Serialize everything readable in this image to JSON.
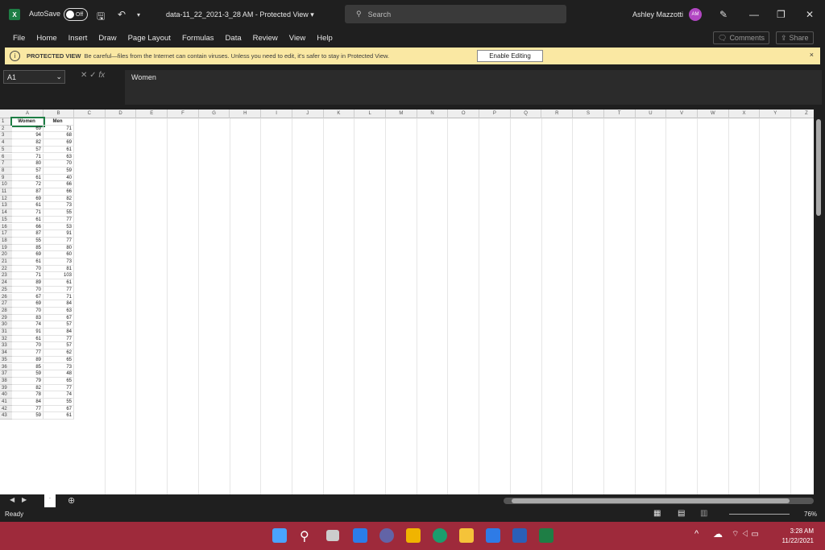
{
  "titlebar": {
    "autosave_label": "AutoSave",
    "autosave_state": "Off",
    "filename": "data-11_22_2021-3_28 AM",
    "separator": " - ",
    "view_mode": "Protected View",
    "search_placeholder": "Search",
    "user_name": "Ashley Mazzotti",
    "user_initials": "AM"
  },
  "menu": [
    "File",
    "Home",
    "Insert",
    "Draw",
    "Page Layout",
    "Formulas",
    "Data",
    "Review",
    "View",
    "Help"
  ],
  "ribbon_buttons": {
    "comments": "Comments",
    "share": "Share"
  },
  "protected": {
    "label": "PROTECTED VIEW",
    "message": "Be careful—files from the Internet can contain viruses. Unless you need to edit, it's safer to stay in Protected View.",
    "enable_button": "Enable Editing",
    "close": "×"
  },
  "formula_bar": {
    "namebox": "A1",
    "fx": "fx",
    "value": "Women"
  },
  "columns": [
    "A",
    "B",
    "C",
    "D",
    "E",
    "F",
    "G",
    "H",
    "I",
    "J",
    "K",
    "L",
    "M",
    "N",
    "O",
    "P",
    "Q",
    "R",
    "S",
    "T",
    "U",
    "V",
    "W",
    "X",
    "Y",
    "Z"
  ],
  "headers": {
    "A": "Women",
    "B": "Men"
  },
  "rows": [
    [
      69,
      71
    ],
    [
      94,
      68
    ],
    [
      82,
      69
    ],
    [
      57,
      61
    ],
    [
      71,
      63
    ],
    [
      80,
      70
    ],
    [
      57,
      59
    ],
    [
      61,
      40
    ],
    [
      72,
      66
    ],
    [
      87,
      66
    ],
    [
      69,
      82
    ],
    [
      61,
      73
    ],
    [
      71,
      55
    ],
    [
      61,
      77
    ],
    [
      66,
      53
    ],
    [
      87,
      91
    ],
    [
      55,
      77
    ],
    [
      85,
      80
    ],
    [
      69,
      60
    ],
    [
      61,
      73
    ],
    [
      70,
      81
    ],
    [
      71,
      103
    ],
    [
      89,
      61
    ],
    [
      70,
      77
    ],
    [
      67,
      71
    ],
    [
      69,
      84
    ],
    [
      70,
      63
    ],
    [
      83,
      67
    ],
    [
      74,
      57
    ],
    [
      91,
      84
    ],
    [
      61,
      77
    ],
    [
      70,
      57
    ],
    [
      77,
      62
    ],
    [
      89,
      65
    ],
    [
      85,
      73
    ],
    [
      59,
      48
    ],
    [
      79,
      65
    ],
    [
      82,
      77
    ],
    [
      78,
      74
    ],
    [
      84,
      55
    ],
    [
      77,
      67
    ],
    [
      59,
      61
    ]
  ],
  "status": {
    "ready": "Ready",
    "zoom": "76%"
  },
  "clock": {
    "time": "3:28 AM",
    "date": "11/22/2021"
  }
}
